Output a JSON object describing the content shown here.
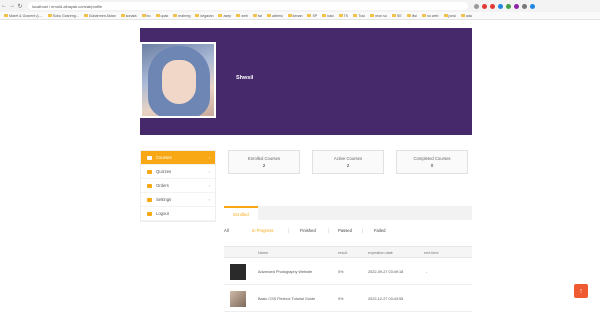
{
  "browser": {
    "url": "localhost / ernold.alhayak.com/at/profile",
    "bookmarks": [
      "Maret & Gosrent (L...",
      "Subu Gosreng...",
      "Gubarmen Aktan",
      "sonata",
      "bu",
      "upak",
      "mahreg",
      "kegaran",
      "asep",
      "web",
      "iwi",
      "adhesi",
      "kenan",
      "SP",
      "kasi",
      "TK",
      "Tulu",
      "mon su",
      "SE",
      "Ilwi",
      "nu web",
      "jonsi",
      "ada"
    ]
  },
  "profile": {
    "name": "Shwsil"
  },
  "menu": {
    "items": [
      {
        "label": "Courses",
        "active": true
      },
      {
        "label": "Quizzes",
        "active": false
      },
      {
        "label": "Orders",
        "active": false
      },
      {
        "label": "Settings",
        "active": false
      },
      {
        "label": "Logout",
        "active": false
      }
    ]
  },
  "stats": {
    "enrolled": {
      "label": "Enrolled Courses",
      "value": "2"
    },
    "active": {
      "label": "Active Courses",
      "value": "2"
    },
    "completed": {
      "label": "Completed Courses",
      "value": "0"
    }
  },
  "course_tabs": {
    "active_label": "Enrolled"
  },
  "filters": {
    "all": "All",
    "in_progress": "In Progress",
    "finished": "Finished",
    "passed": "Passed",
    "failed": "Failed"
  },
  "table": {
    "headers": {
      "name": "Name",
      "result": "result",
      "expiration": "expiration date",
      "end_time": "end time"
    },
    "rows": [
      {
        "name": "Advanced Photography Website",
        "result": "0%",
        "expiration": "2022-09-27 03:49:18",
        "end_time": "-"
      },
      {
        "name": "Basic CSS Flexbox Tutorial Guide",
        "result": "0%",
        "expiration": "2022-12-27 03:43:55",
        "end_time": ""
      }
    ]
  },
  "colors": {
    "brand_purple": "#46296b",
    "accent_orange": "#f7a814",
    "scroll_button": "#ef5a32"
  },
  "icons": {
    "scroll_top": "arrow-up-icon"
  }
}
